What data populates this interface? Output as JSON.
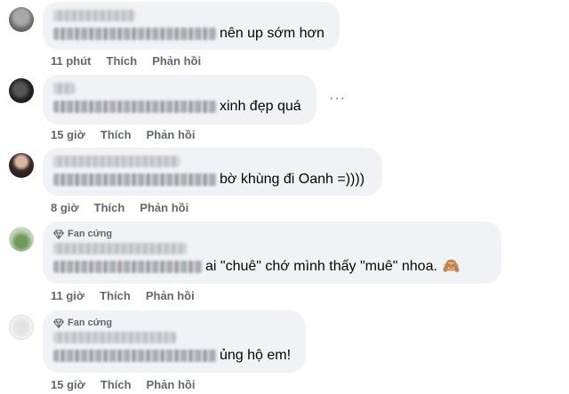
{
  "comments": [
    {
      "text": "nên up sớm hơn",
      "time": "11 phút",
      "like": "Thích",
      "reply": "Phản hồi"
    },
    {
      "text": "xinh đẹp quá",
      "time": "15 giờ",
      "like": "Thích",
      "reply": "Phản hồi",
      "more": "···"
    },
    {
      "text": "bờ khùng đi Oanh =))))",
      "time": "8 giờ",
      "like": "Thích",
      "reply": "Phản hồi"
    },
    {
      "badge": "Fan cứng",
      "text": "ai \"chuê\" chớ mình thấy \"muê\" nhoa.",
      "emoji": "🙈",
      "time": "11 giờ",
      "like": "Thích",
      "reply": "Phản hồi"
    },
    {
      "badge": "Fan cứng",
      "text": "ủng hộ em!",
      "time": "15 giờ",
      "like": "Thích",
      "reply": "Phản hồi"
    }
  ]
}
